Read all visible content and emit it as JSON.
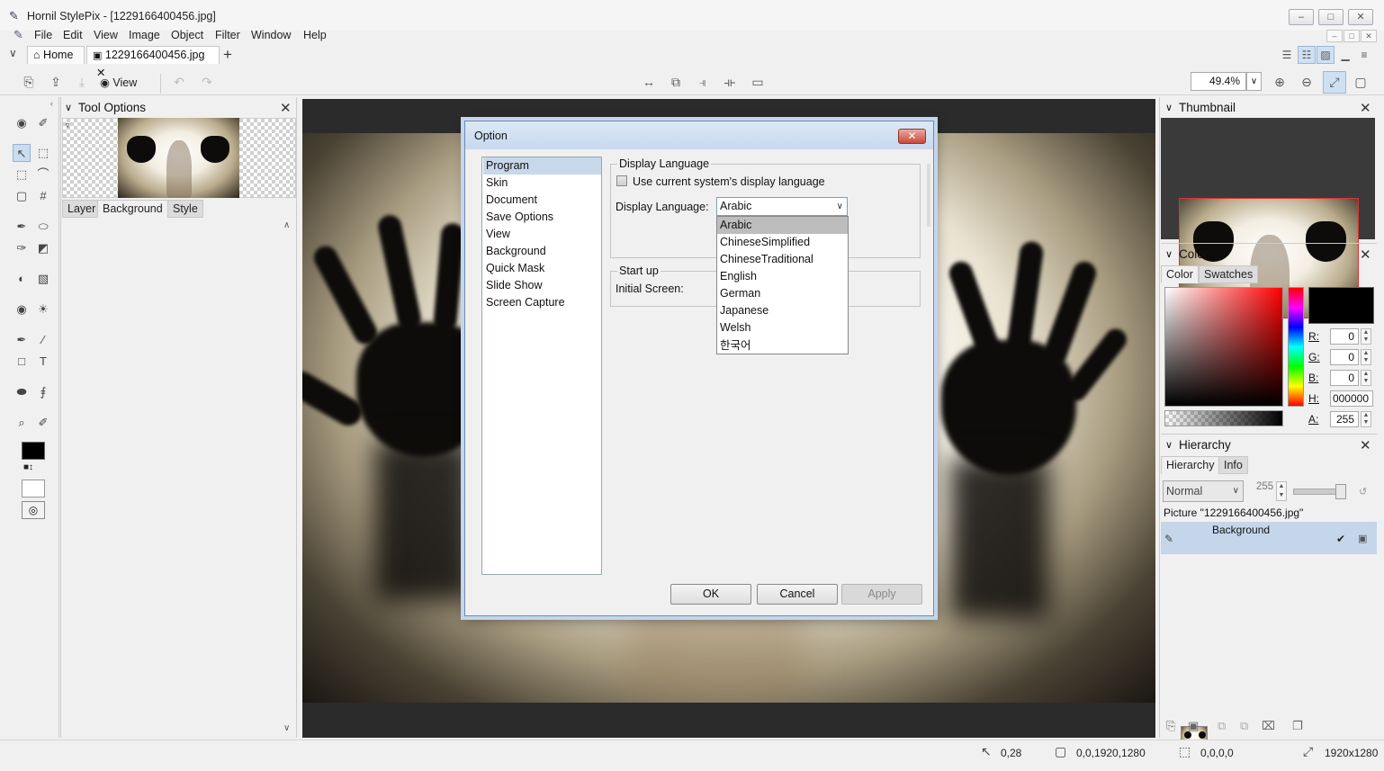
{
  "window": {
    "title": "Hornil StylePix - [1229166400456.jpg]",
    "minimize_icon": "–",
    "maximize_icon": "□",
    "close_icon": "✕"
  },
  "menu": [
    "File",
    "Edit",
    "View",
    "Image",
    "Object",
    "Filter",
    "Window",
    "Help"
  ],
  "tabs": {
    "home": "Home",
    "document": "1229166400456.jpg",
    "add": "+"
  },
  "toolbar": {
    "view_label": "View",
    "zoom": "49.4%"
  },
  "tool_options": {
    "title": "Tool Options",
    "tabs": [
      "Layer",
      "Background",
      "Style"
    ]
  },
  "dialog": {
    "title": "Option",
    "close": "✕",
    "categories": [
      "Program",
      "Skin",
      "Document",
      "Save Options",
      "View",
      "Background",
      "Quick Mask",
      "Slide Show",
      "Screen Capture"
    ],
    "selected_category": "Program",
    "display_language_group": "Display Language",
    "use_system_lang": "Use current system's display language",
    "display_language_label": "Display Language:",
    "display_language_value": "Arabic",
    "languages": [
      "Arabic",
      "ChineseSimplified",
      "ChineseTraditional",
      "English",
      "German",
      "Japanese",
      "Welsh",
      "한국어"
    ],
    "startup_group": "Start up",
    "initial_screen_label": "Initial Screen:",
    "ok": "OK",
    "cancel": "Cancel",
    "apply": "Apply"
  },
  "thumbnail_panel": {
    "title": "Thumbnail"
  },
  "color_panel": {
    "title": "Color",
    "tabs": [
      "Color",
      "Swatches"
    ],
    "r_label": "R:",
    "r": "0",
    "g_label": "G:",
    "g": "0",
    "b_label": "B:",
    "b": "0",
    "h_label": "H:",
    "hex": "000000",
    "a_label": "A:",
    "a": "255",
    "current_color": "#000000"
  },
  "hierarchy_panel": {
    "title": "Hierarchy",
    "tabs": [
      "Hierarchy",
      "Info"
    ],
    "blend_mode": "Normal",
    "opacity": "255",
    "picture_label": "Picture \"1229166400456.jpg\"",
    "layer_name": "Background"
  },
  "status": {
    "cursor": "0,28",
    "selection_rect": "0,0,1920,1280",
    "selection_size": "0,0,0,0",
    "image_size": "1920x1280"
  }
}
